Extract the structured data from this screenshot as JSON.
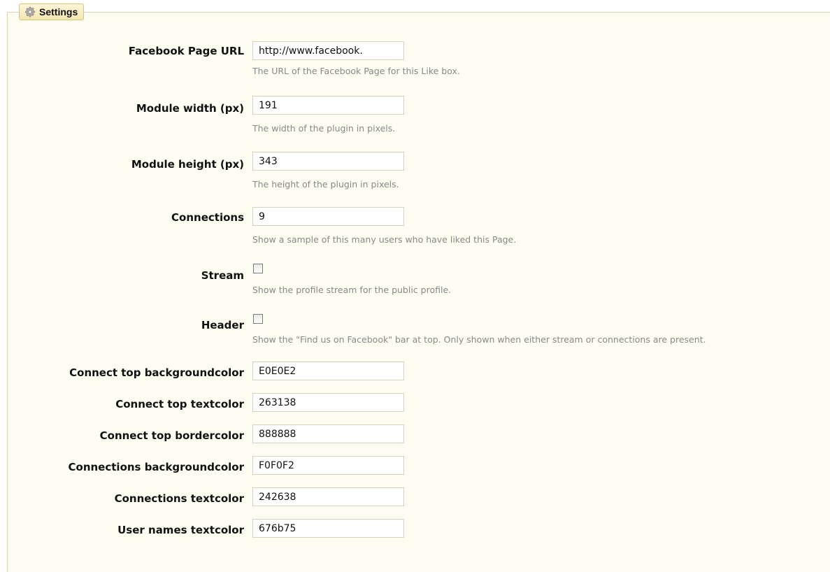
{
  "legend": {
    "title": "Settings",
    "icon": "gear-icon"
  },
  "fields": {
    "page_url": {
      "label": "Facebook Page URL",
      "value": "http://www.facebook.",
      "description": "The URL of the Facebook Page for this Like box."
    },
    "width": {
      "label": "Module width (px)",
      "value": "191",
      "description": "The width of the plugin in pixels."
    },
    "height": {
      "label": "Module height (px)",
      "value": "343",
      "description": "The height of the plugin in pixels."
    },
    "connections": {
      "label": "Connections",
      "value": "9",
      "description": "Show a sample of this many users who have liked this Page."
    },
    "stream": {
      "label": "Stream",
      "checked": false,
      "description": "Show the profile stream for the public profile."
    },
    "header": {
      "label": "Header",
      "checked": false,
      "description": "Show the \"Find us on Facebook\" bar at top. Only shown when either stream or connections are present."
    },
    "connect_top_bg": {
      "label": "Connect top backgroundcolor",
      "value": "E0E0E2"
    },
    "connect_top_text": {
      "label": "Connect top textcolor",
      "value": "263138"
    },
    "connect_top_border": {
      "label": "Connect top bordercolor",
      "value": "888888"
    },
    "connections_bg": {
      "label": "Connections backgroundcolor",
      "value": "F0F0F2"
    },
    "connections_text": {
      "label": "Connections textcolor",
      "value": "242638"
    },
    "user_names_text": {
      "label": "User names textcolor",
      "value": "676b75"
    }
  }
}
